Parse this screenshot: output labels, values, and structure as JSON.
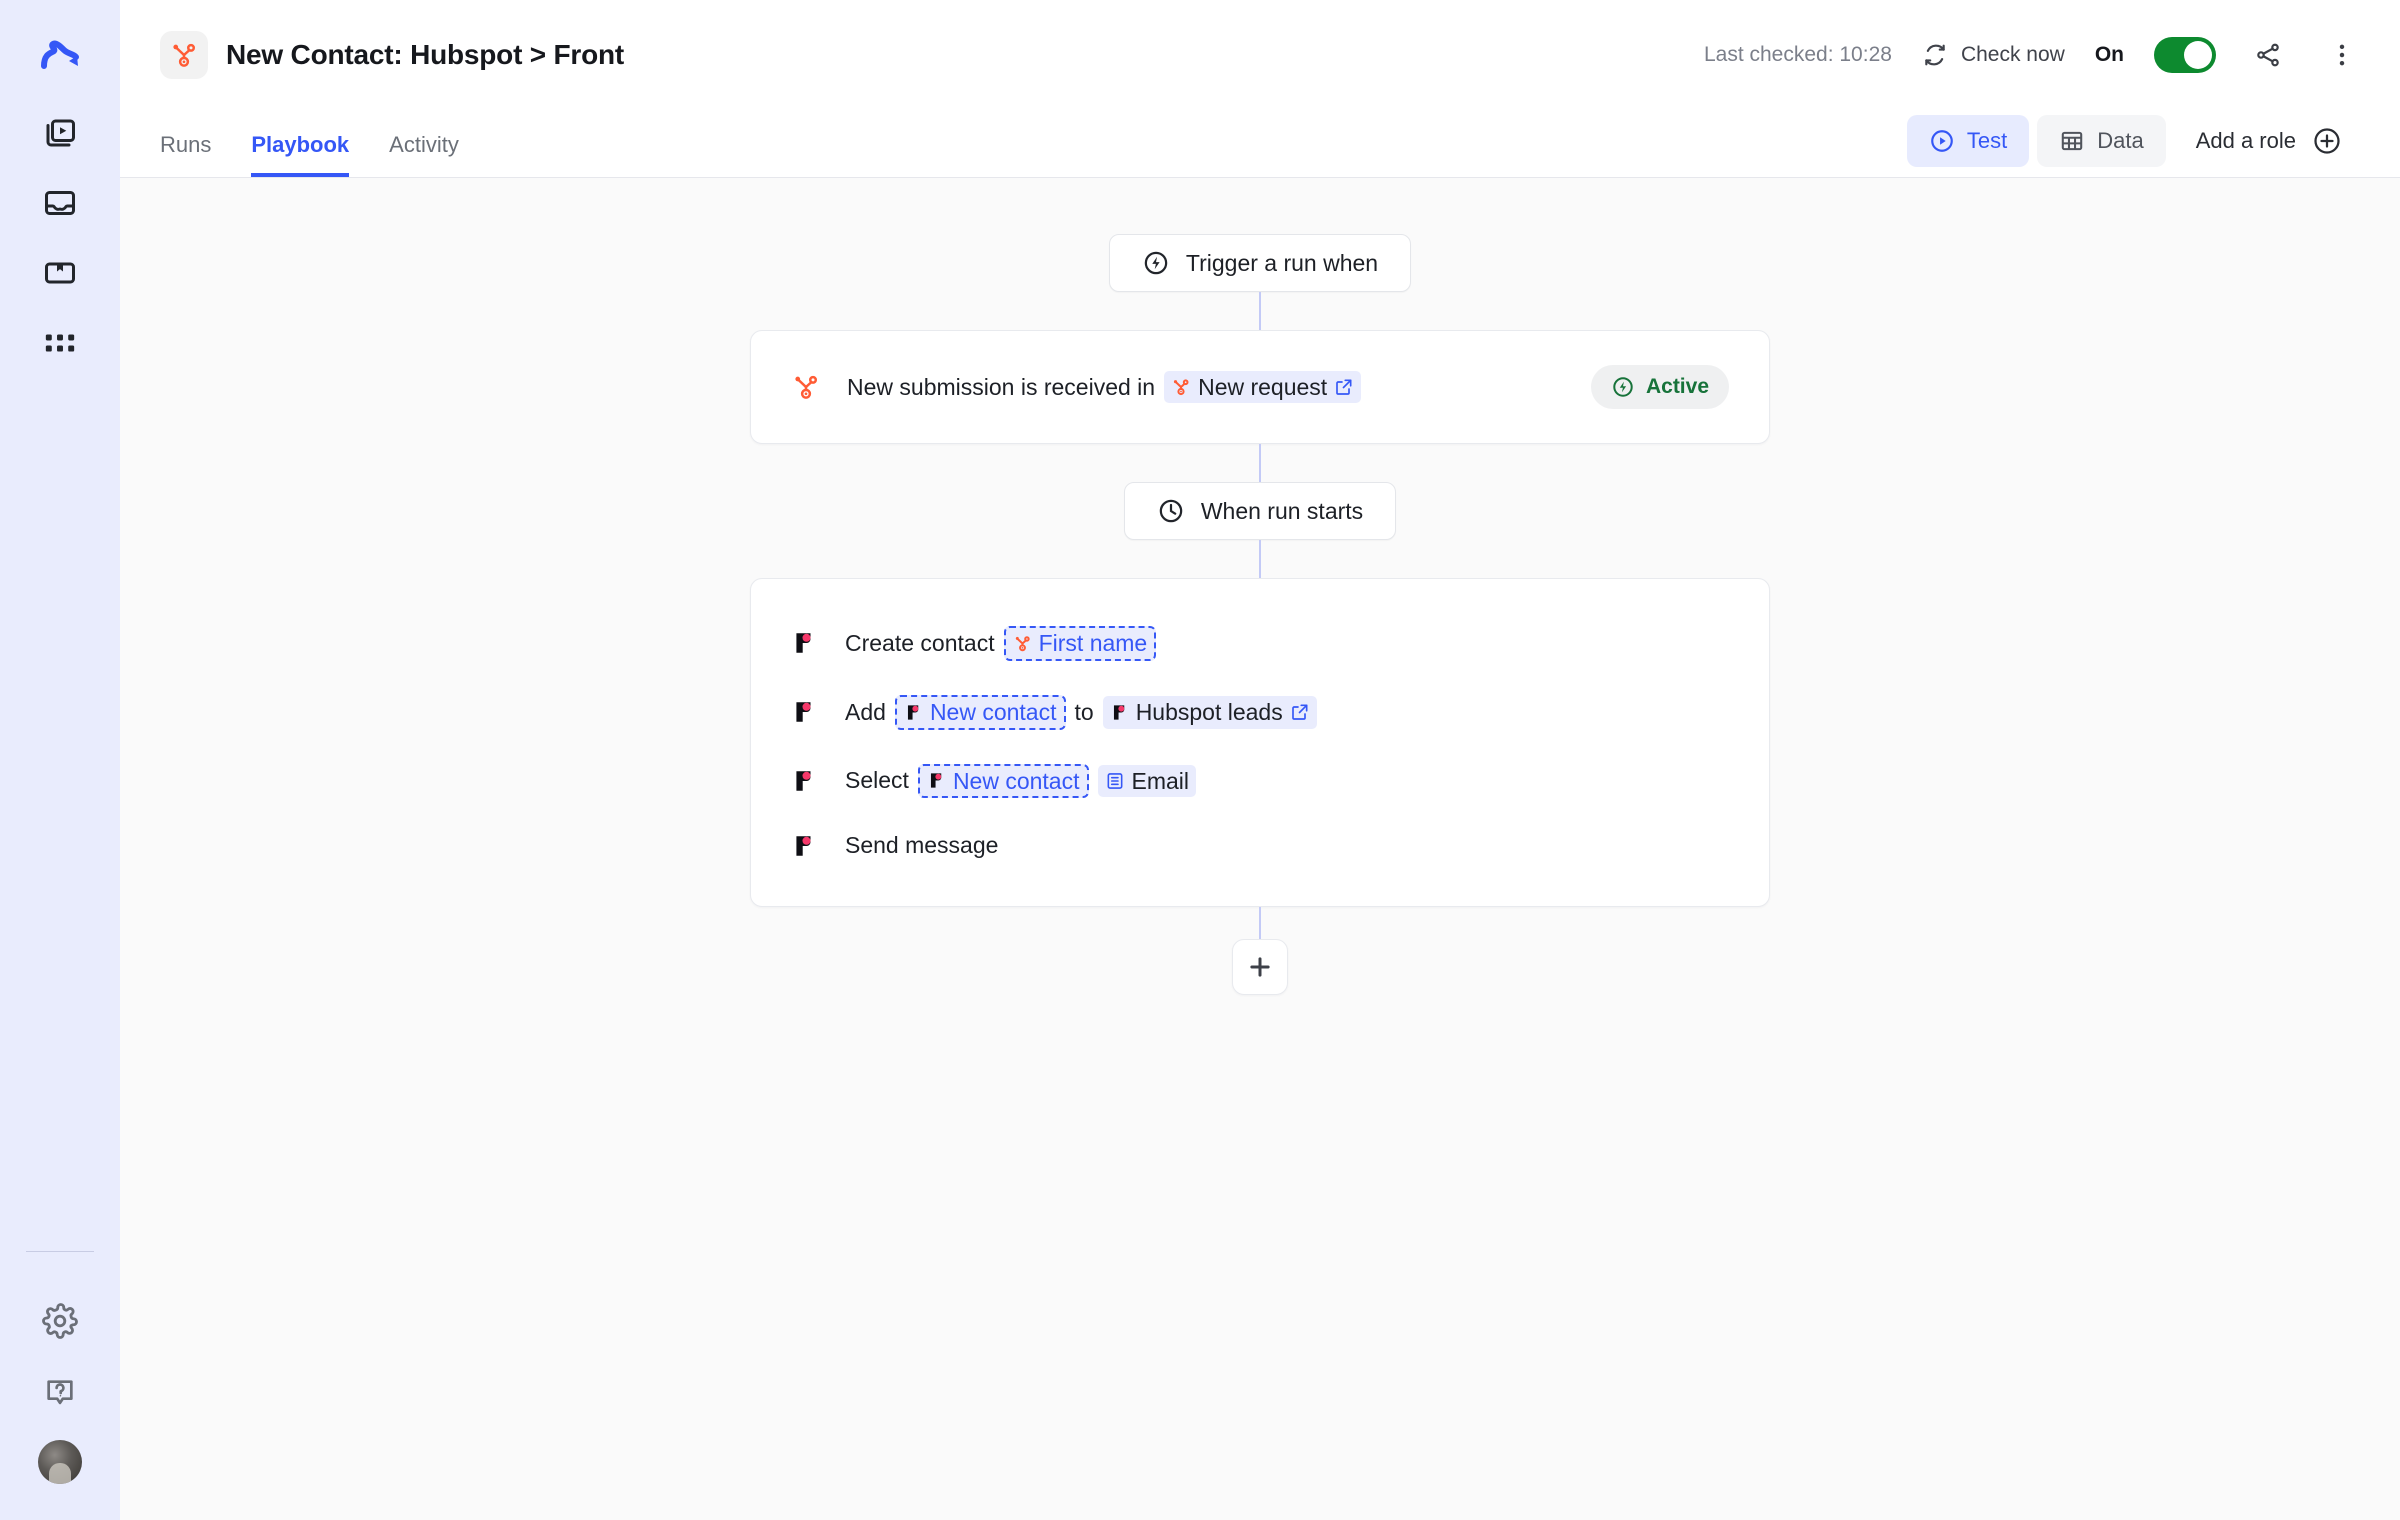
{
  "sidebar": {
    "logo_name": "relay-logo",
    "items": [
      {
        "icon": "playbooks-icon",
        "name": "sidebar-item-playbooks"
      },
      {
        "icon": "inbox-icon",
        "name": "sidebar-item-inbox"
      },
      {
        "icon": "library-icon",
        "name": "sidebar-item-library"
      },
      {
        "icon": "apps-grid-icon",
        "name": "sidebar-item-apps"
      }
    ],
    "bottom": [
      {
        "icon": "gear-icon",
        "name": "sidebar-item-settings"
      },
      {
        "icon": "help-icon",
        "name": "sidebar-item-help"
      },
      {
        "icon": "avatar",
        "name": "sidebar-avatar"
      }
    ]
  },
  "header": {
    "app_icon": "hubspot-icon",
    "title": "New Contact: Hubspot > Front",
    "last_checked": "Last checked: 10:28",
    "check_now_label": "Check now",
    "check_now_icon": "refresh-icon",
    "toggle_label": "On",
    "toggle_on": true,
    "toggle_color": "#0d8a2f",
    "share_icon": "share-icon",
    "more_icon": "more-vertical-icon"
  },
  "tabs": [
    {
      "label": "Runs",
      "active": false
    },
    {
      "label": "Playbook",
      "active": true
    },
    {
      "label": "Activity",
      "active": false
    }
  ],
  "tab_actions": {
    "test_label": "Test",
    "test_icon": "play-circle-icon",
    "data_label": "Data",
    "data_icon": "table-icon",
    "role_label": "Add a role",
    "role_icon": "plus-circle-icon"
  },
  "flow": {
    "trigger_pill": {
      "label": "Trigger a run when",
      "icon": "bolt-circle-icon"
    },
    "trigger_card": {
      "app_icon": "hubspot-icon",
      "text_before": "New submission is received in",
      "chip": {
        "label": "New request",
        "icon": "hubspot-icon",
        "external": true
      },
      "status": {
        "label": "Active",
        "icon": "bolt-circle-icon",
        "color": "#17733a"
      }
    },
    "start_pill": {
      "label": "When run starts",
      "icon": "clock-icon"
    },
    "actions": [
      {
        "icon": "front-icon",
        "parts": [
          {
            "type": "text",
            "value": "Create contact"
          },
          {
            "type": "var",
            "value": "First name",
            "icon": "hubspot-icon"
          }
        ]
      },
      {
        "icon": "front-icon",
        "parts": [
          {
            "type": "text",
            "value": "Add"
          },
          {
            "type": "var",
            "value": "New contact",
            "icon": "front-icon"
          },
          {
            "type": "text",
            "value": "to"
          },
          {
            "type": "chip",
            "value": "Hubspot leads",
            "icon": "front-icon",
            "external": true
          }
        ]
      },
      {
        "icon": "front-icon",
        "parts": [
          {
            "type": "text",
            "value": "Select"
          },
          {
            "type": "var",
            "value": "New contact",
            "icon": "front-icon"
          },
          {
            "type": "chip",
            "value": "Email",
            "icon": "list-icon",
            "external": false
          }
        ]
      },
      {
        "icon": "front-icon",
        "parts": [
          {
            "type": "text",
            "value": "Send message"
          }
        ]
      }
    ],
    "add_step_icon": "plus-icon"
  },
  "colors": {
    "accent_blue": "#3557f6",
    "sidebar_bg": "#e9ecfd",
    "canvas_bg": "#fafafa",
    "hubspot_orange": "#ff5c35",
    "front_pink": "#f5386a",
    "active_green": "#17733a"
  }
}
